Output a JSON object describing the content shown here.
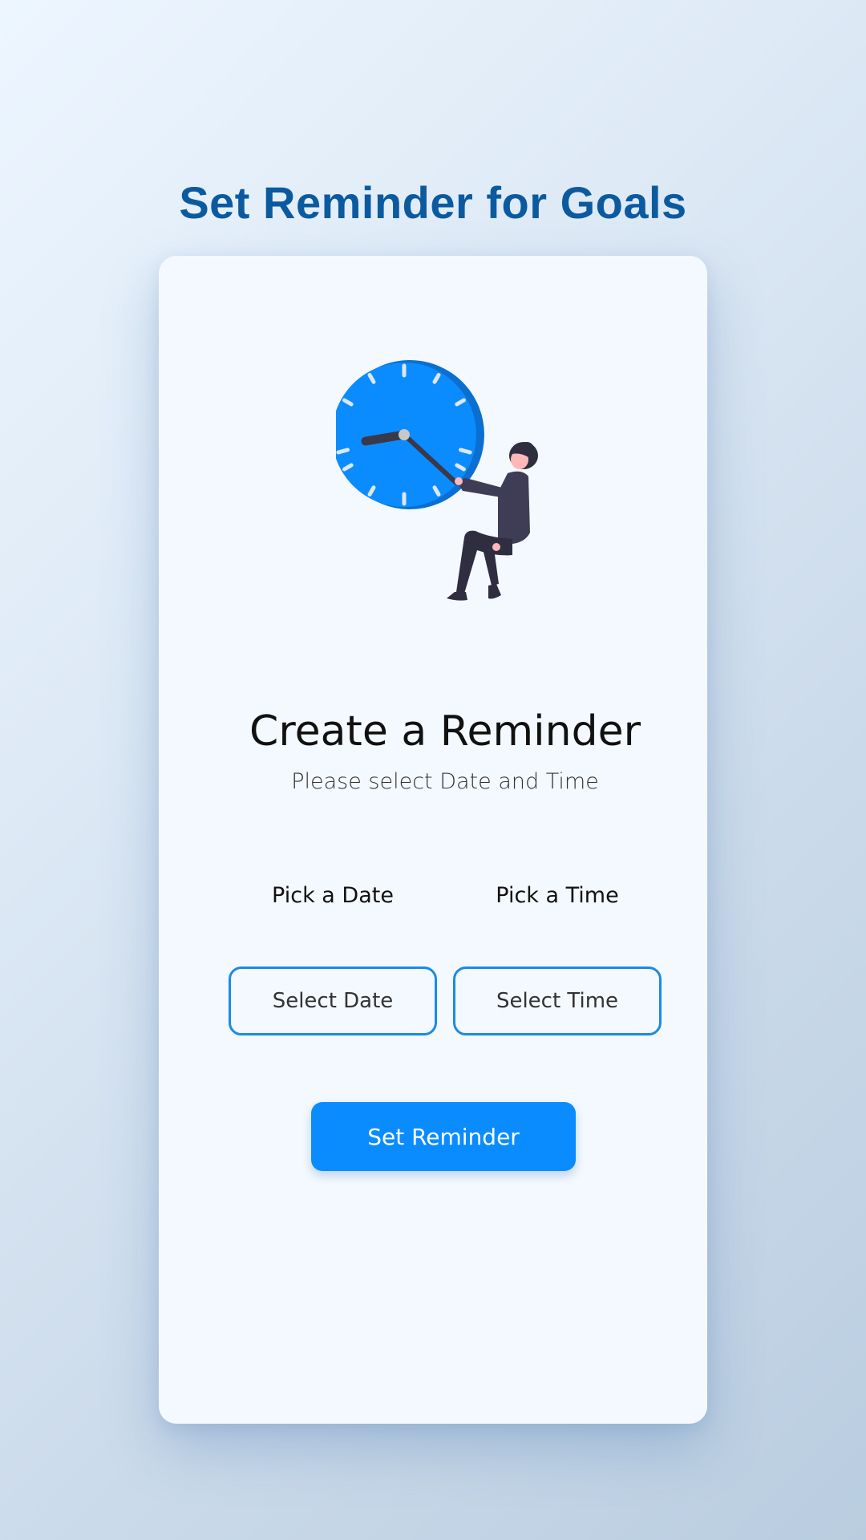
{
  "page": {
    "title": "Set Reminder for Goals"
  },
  "card": {
    "heading": "Create a Reminder",
    "subtitle": "Please select Date and Time",
    "date_label": "Pick a Date",
    "time_label": "Pick a Time",
    "date_placeholder": "Select Date",
    "time_placeholder": "Select Time",
    "submit_label": "Set Reminder"
  },
  "colors": {
    "title": "#0b5aa0",
    "accent": "#0a8cff",
    "picker_border": "#1a8be6",
    "card_bg": "#f4f9ff"
  },
  "icons": {
    "illustration": "woman-pulling-clock-hand-illustration"
  }
}
